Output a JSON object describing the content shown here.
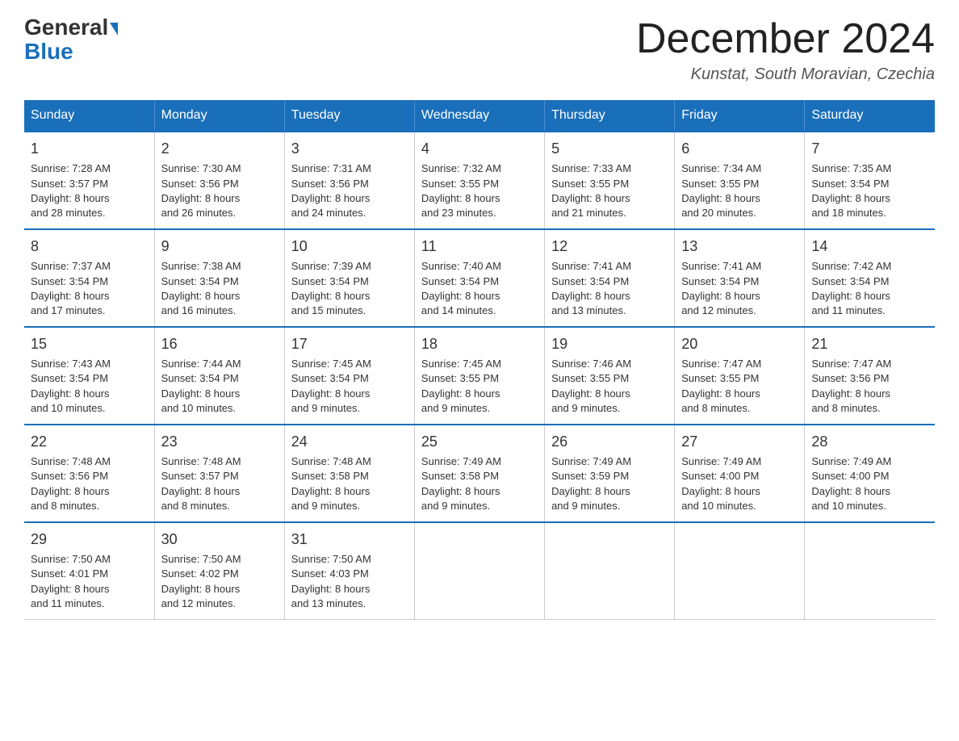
{
  "logo": {
    "part1": "General",
    "triangle": "▶",
    "part2": "Blue"
  },
  "title": "December 2024",
  "subtitle": "Kunstat, South Moravian, Czechia",
  "days": [
    "Sunday",
    "Monday",
    "Tuesday",
    "Wednesday",
    "Thursday",
    "Friday",
    "Saturday"
  ],
  "weeks": [
    [
      {
        "day": "1",
        "sunrise": "7:28 AM",
        "sunset": "3:57 PM",
        "daylight": "8 hours and 28 minutes."
      },
      {
        "day": "2",
        "sunrise": "7:30 AM",
        "sunset": "3:56 PM",
        "daylight": "8 hours and 26 minutes."
      },
      {
        "day": "3",
        "sunrise": "7:31 AM",
        "sunset": "3:56 PM",
        "daylight": "8 hours and 24 minutes."
      },
      {
        "day": "4",
        "sunrise": "7:32 AM",
        "sunset": "3:55 PM",
        "daylight": "8 hours and 23 minutes."
      },
      {
        "day": "5",
        "sunrise": "7:33 AM",
        "sunset": "3:55 PM",
        "daylight": "8 hours and 21 minutes."
      },
      {
        "day": "6",
        "sunrise": "7:34 AM",
        "sunset": "3:55 PM",
        "daylight": "8 hours and 20 minutes."
      },
      {
        "day": "7",
        "sunrise": "7:35 AM",
        "sunset": "3:54 PM",
        "daylight": "8 hours and 18 minutes."
      }
    ],
    [
      {
        "day": "8",
        "sunrise": "7:37 AM",
        "sunset": "3:54 PM",
        "daylight": "8 hours and 17 minutes."
      },
      {
        "day": "9",
        "sunrise": "7:38 AM",
        "sunset": "3:54 PM",
        "daylight": "8 hours and 16 minutes."
      },
      {
        "day": "10",
        "sunrise": "7:39 AM",
        "sunset": "3:54 PM",
        "daylight": "8 hours and 15 minutes."
      },
      {
        "day": "11",
        "sunrise": "7:40 AM",
        "sunset": "3:54 PM",
        "daylight": "8 hours and 14 minutes."
      },
      {
        "day": "12",
        "sunrise": "7:41 AM",
        "sunset": "3:54 PM",
        "daylight": "8 hours and 13 minutes."
      },
      {
        "day": "13",
        "sunrise": "7:41 AM",
        "sunset": "3:54 PM",
        "daylight": "8 hours and 12 minutes."
      },
      {
        "day": "14",
        "sunrise": "7:42 AM",
        "sunset": "3:54 PM",
        "daylight": "8 hours and 11 minutes."
      }
    ],
    [
      {
        "day": "15",
        "sunrise": "7:43 AM",
        "sunset": "3:54 PM",
        "daylight": "8 hours and 10 minutes."
      },
      {
        "day": "16",
        "sunrise": "7:44 AM",
        "sunset": "3:54 PM",
        "daylight": "8 hours and 10 minutes."
      },
      {
        "day": "17",
        "sunrise": "7:45 AM",
        "sunset": "3:54 PM",
        "daylight": "8 hours and 9 minutes."
      },
      {
        "day": "18",
        "sunrise": "7:45 AM",
        "sunset": "3:55 PM",
        "daylight": "8 hours and 9 minutes."
      },
      {
        "day": "19",
        "sunrise": "7:46 AM",
        "sunset": "3:55 PM",
        "daylight": "8 hours and 9 minutes."
      },
      {
        "day": "20",
        "sunrise": "7:47 AM",
        "sunset": "3:55 PM",
        "daylight": "8 hours and 8 minutes."
      },
      {
        "day": "21",
        "sunrise": "7:47 AM",
        "sunset": "3:56 PM",
        "daylight": "8 hours and 8 minutes."
      }
    ],
    [
      {
        "day": "22",
        "sunrise": "7:48 AM",
        "sunset": "3:56 PM",
        "daylight": "8 hours and 8 minutes."
      },
      {
        "day": "23",
        "sunrise": "7:48 AM",
        "sunset": "3:57 PM",
        "daylight": "8 hours and 8 minutes."
      },
      {
        "day": "24",
        "sunrise": "7:48 AM",
        "sunset": "3:58 PM",
        "daylight": "8 hours and 9 minutes."
      },
      {
        "day": "25",
        "sunrise": "7:49 AM",
        "sunset": "3:58 PM",
        "daylight": "8 hours and 9 minutes."
      },
      {
        "day": "26",
        "sunrise": "7:49 AM",
        "sunset": "3:59 PM",
        "daylight": "8 hours and 9 minutes."
      },
      {
        "day": "27",
        "sunrise": "7:49 AM",
        "sunset": "4:00 PM",
        "daylight": "8 hours and 10 minutes."
      },
      {
        "day": "28",
        "sunrise": "7:49 AM",
        "sunset": "4:00 PM",
        "daylight": "8 hours and 10 minutes."
      }
    ],
    [
      {
        "day": "29",
        "sunrise": "7:50 AM",
        "sunset": "4:01 PM",
        "daylight": "8 hours and 11 minutes."
      },
      {
        "day": "30",
        "sunrise": "7:50 AM",
        "sunset": "4:02 PM",
        "daylight": "8 hours and 12 minutes."
      },
      {
        "day": "31",
        "sunrise": "7:50 AM",
        "sunset": "4:03 PM",
        "daylight": "8 hours and 13 minutes."
      },
      null,
      null,
      null,
      null
    ]
  ]
}
